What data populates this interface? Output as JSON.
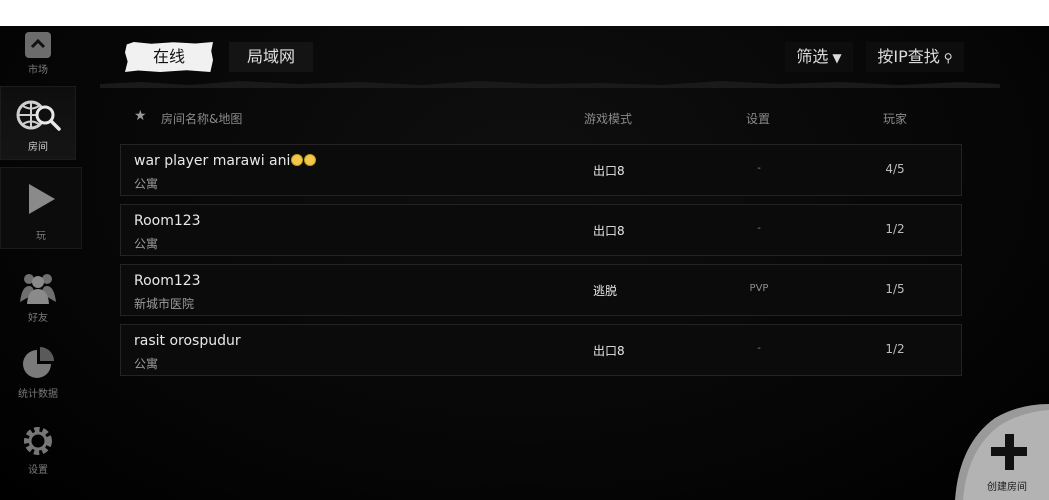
{
  "sidebar": {
    "items": [
      {
        "label": "市场",
        "icon": "market-icon"
      },
      {
        "label": "房间",
        "icon": "globe-search-icon"
      },
      {
        "label": "玩",
        "icon": "play-icon"
      },
      {
        "label": "好友",
        "icon": "friends-icon"
      },
      {
        "label": "统计数据",
        "icon": "pie-chart-icon"
      },
      {
        "label": "设置",
        "icon": "gear-icon"
      }
    ]
  },
  "tabs": {
    "online": "在线",
    "lan": "局域网"
  },
  "toolbar": {
    "filter": "筛选",
    "filter_icon": "▼",
    "ip_search": "按IP查找",
    "search_icon": "⚲"
  },
  "table": {
    "headers": {
      "name": "房间名称&地图",
      "mode": "游戏模式",
      "settings": "设置",
      "players": "玩家"
    },
    "rows": [
      {
        "name": "war player marawi ani",
        "map": "公寓",
        "mode": "出口8",
        "setting": "-",
        "players": "4/5"
      },
      {
        "name": "Room123",
        "map": "公寓",
        "mode": "出口8",
        "setting": "-",
        "players": "1/2"
      },
      {
        "name": "Room123",
        "map": "新城市医院",
        "mode": "逃脱",
        "setting": "PVP",
        "players": "1/5"
      },
      {
        "name": "rasit orospudur",
        "map": "公寓",
        "mode": "出口8",
        "setting": "-",
        "players": "1/2"
      }
    ]
  },
  "create_room": {
    "label": "创建房间"
  },
  "colors": {
    "background": "#050505",
    "row_bg": "#0b0b0b",
    "active_tab": "#f1f1f1",
    "accent_corner": "#9a9a9a"
  }
}
